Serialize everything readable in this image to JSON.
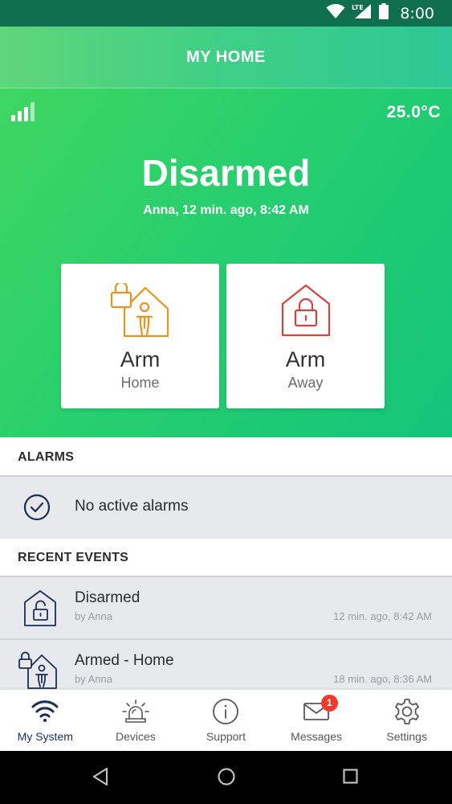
{
  "status_bar": {
    "network": "LTE",
    "time": "8:00"
  },
  "app_bar": {
    "title": "MY HOME"
  },
  "hero": {
    "temperature": "25.0°C",
    "state": "Disarmed",
    "detail": "Anna, 12 min. ago, 8:42 AM",
    "arm_home": {
      "label": "Arm",
      "sub": "Home",
      "icon": "house-person-lock-icon",
      "color": "#e8941f"
    },
    "arm_away": {
      "label": "Arm",
      "sub": "Away",
      "icon": "house-lock-icon",
      "color": "#d64141"
    }
  },
  "alarms": {
    "header": "ALARMS",
    "message": "No active alarms",
    "icon": "check-circle-icon"
  },
  "recent_events": {
    "header": "RECENT EVENTS",
    "items": [
      {
        "title": "Disarmed",
        "by": "by Anna",
        "when": "12 min. ago, 8:42 AM",
        "icon": "house-unlocked-icon"
      },
      {
        "title": "Armed - Home",
        "by": "by Anna",
        "when": "18 min. ago, 8:36 AM",
        "icon": "house-person-lock-icon"
      }
    ]
  },
  "bottom_nav": {
    "items": [
      {
        "label": "My System",
        "icon": "wifi-icon",
        "active": true
      },
      {
        "label": "Devices",
        "icon": "siren-icon"
      },
      {
        "label": "Support",
        "icon": "info-icon"
      },
      {
        "label": "Messages",
        "icon": "envelope-icon",
        "badge": "1"
      },
      {
        "label": "Settings",
        "icon": "gear-icon"
      }
    ]
  },
  "colors": {
    "primary_green": "#27cf6e",
    "nav_active": "#1c2d5a",
    "badge": "#ef3b2d",
    "row_bg": "#e8e9ed"
  }
}
